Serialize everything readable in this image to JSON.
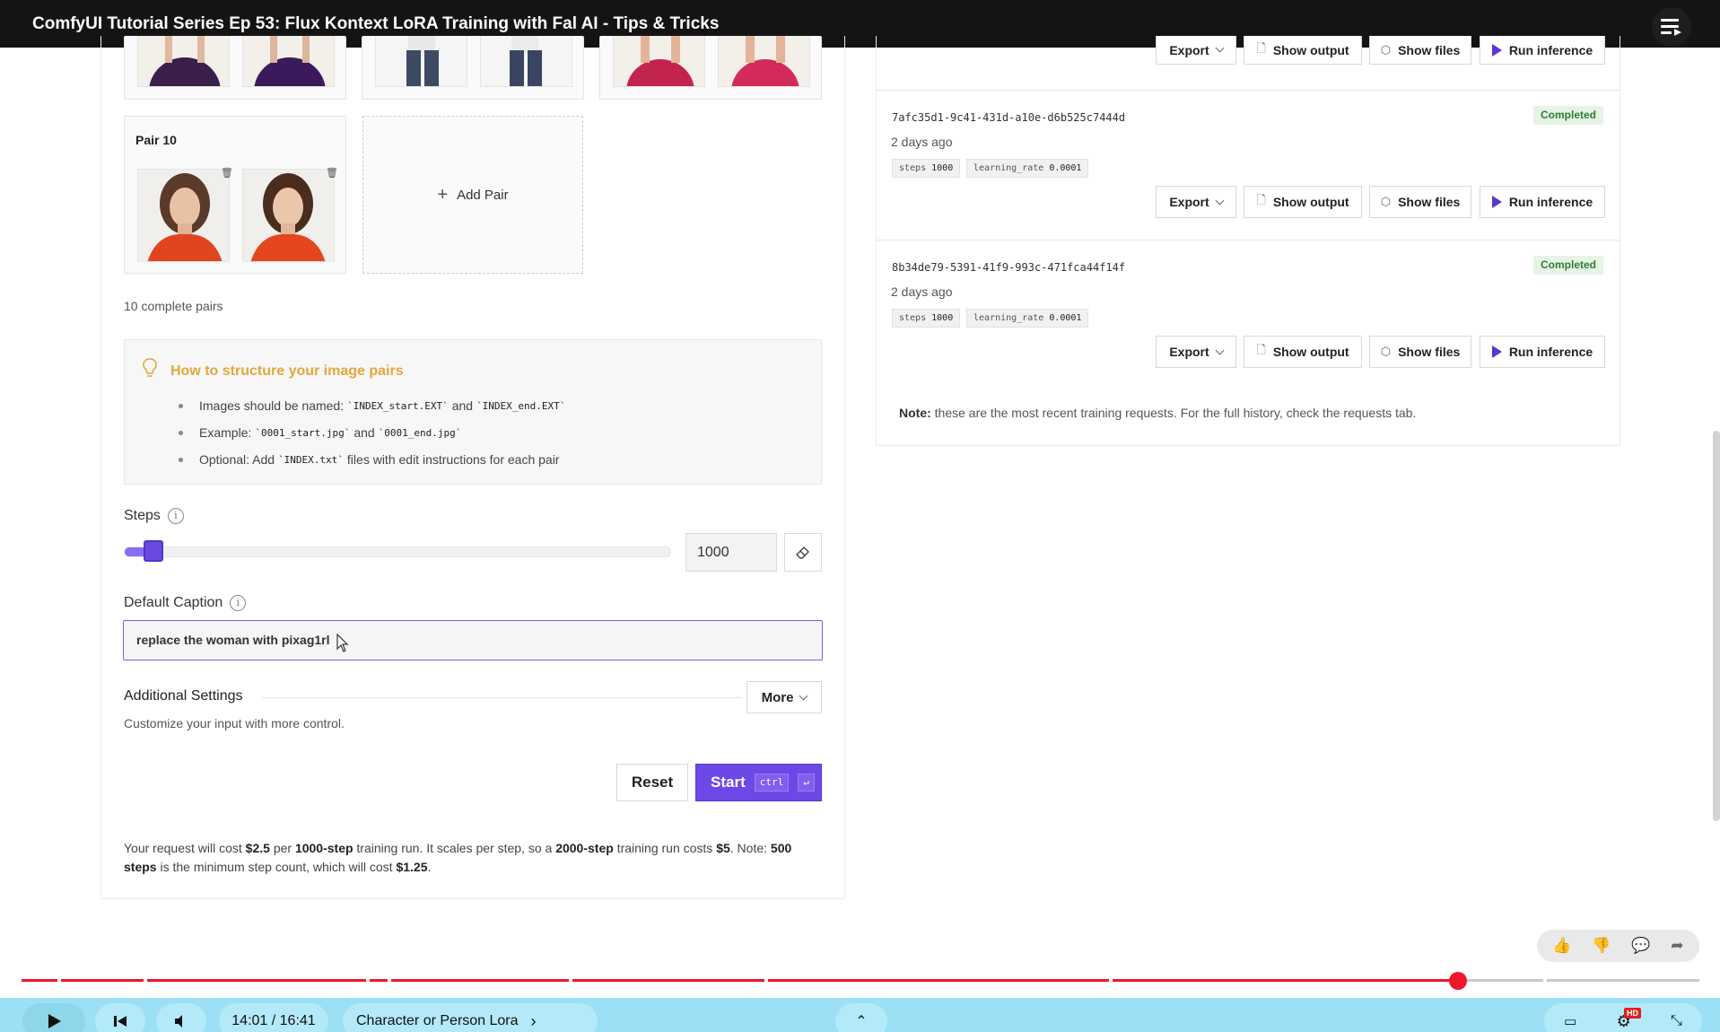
{
  "video": {
    "title": "ComfyUI Tutorial Series Ep 53: Flux Kontext LoRA Training with Fal AI - Tips & Tricks",
    "time": "14:01 / 16:41",
    "chapter": "Character or Person Lora",
    "progress": 0.856,
    "hd_badge": "HD"
  },
  "pairs": {
    "pair10_title": "Pair 10",
    "add_pair_label": "Add Pair",
    "complete_count_text": "10 complete pairs"
  },
  "how": {
    "heading": "How to structure your image pairs",
    "b1_pre": "Images should be named:",
    "b1_code1": "`INDEX_start.EXT`",
    "b1_mid": "and",
    "b1_code2": "`INDEX_end.EXT`",
    "b2_pre": "Example:",
    "b2_code1": "`0001_start.jpg`",
    "b2_mid": "and",
    "b2_code2": "`0001_end.jpg`",
    "b3_pre": "Optional: Add",
    "b3_code": "`INDEX.txt`",
    "b3_post": "files with edit instructions for each pair"
  },
  "steps": {
    "label": "Steps",
    "value": "1000",
    "slider_fraction": 0.03
  },
  "caption": {
    "label": "Default Caption",
    "value": "replace the woman with pixag1rl"
  },
  "additional": {
    "title": "Additional Settings",
    "more_label": "More",
    "desc": "Customize your input with more control."
  },
  "actions": {
    "reset_label": "Reset",
    "start_label": "Start",
    "kbd_ctrl": "ctrl",
    "kbd_enter": "↵"
  },
  "cost": {
    "p1": "Your request will cost",
    "price": "$2.5",
    "p2": "per",
    "steps_ref": "1000-step",
    "p3": "training run. It scales per step, so a",
    "steps2": "2000-step",
    "p4": "training run costs",
    "price2": "$5",
    "p5": ". Note:",
    "min_steps": "500 steps",
    "p6": "is the minimum step count, which will cost",
    "price3": "$1.25",
    "p7": "."
  },
  "requests": [
    {
      "id": "7afc35d1-9c41-431d-a10e-d6b525c7444d",
      "time": "2 days ago",
      "status": "Completed",
      "tag1_key": "steps",
      "tag1_val": "1000",
      "tag2_key": "learning_rate",
      "tag2_val": "0.0001"
    },
    {
      "id": "8b34de79-5391-41f9-993c-471fca44f14f",
      "time": "2 days ago",
      "status": "Completed",
      "tag1_key": "steps",
      "tag1_val": "1000",
      "tag2_key": "learning_rate",
      "tag2_val": "0.0001"
    }
  ],
  "request_buttons": {
    "export": "Export",
    "show_output": "Show output",
    "show_files": "Show files",
    "run_inference": "Run inference"
  },
  "note": {
    "bold": "Note:",
    "text": "these are the most recent training requests. For the full history, check the requests tab."
  },
  "colors": {
    "accent": "#6d48e7",
    "progress_red": "#f0162b",
    "completed_green": "#2e7d32",
    "how_heading": "#e2a83c"
  }
}
